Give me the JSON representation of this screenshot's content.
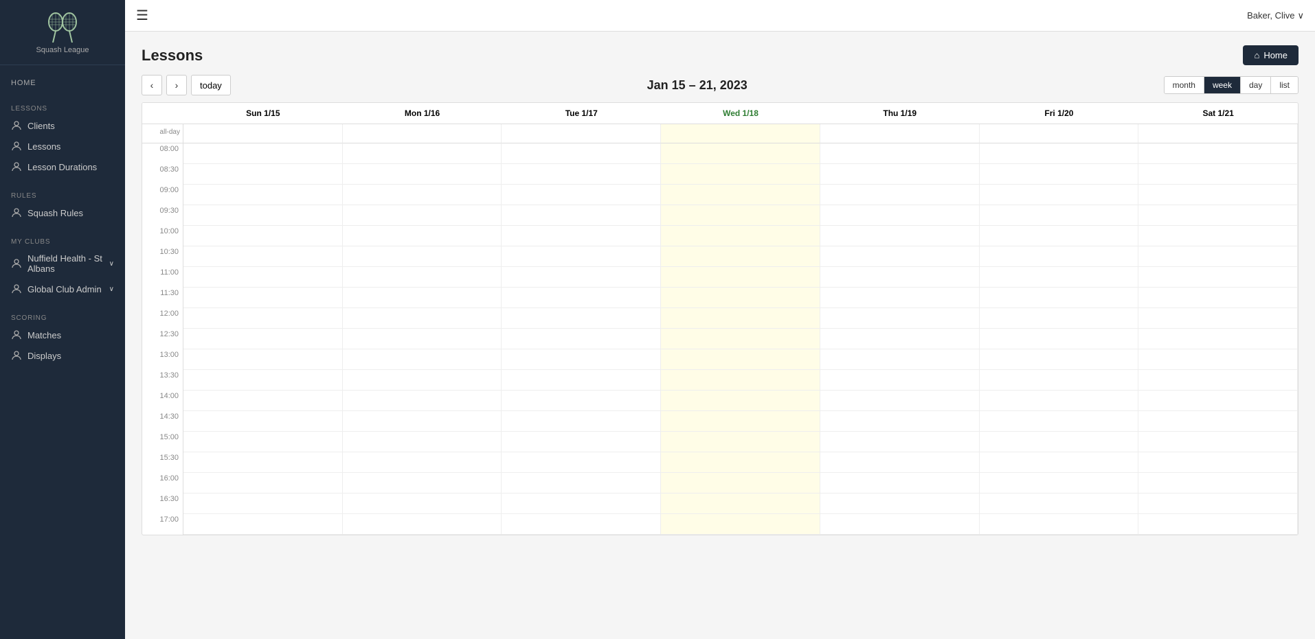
{
  "app": {
    "logo_text": "Squash League",
    "menu_icon": "☰"
  },
  "topbar": {
    "user_label": "Baker, Clive",
    "user_chevron": "∨"
  },
  "sidebar": {
    "home_label": "HOME",
    "sections": [
      {
        "name": "Lessons",
        "items": [
          {
            "id": "clients",
            "label": "Clients"
          },
          {
            "id": "lessons",
            "label": "Lessons"
          },
          {
            "id": "lesson-durations",
            "label": "Lesson Durations"
          }
        ]
      },
      {
        "name": "Rules",
        "items": [
          {
            "id": "squash-rules",
            "label": "Squash Rules"
          }
        ]
      },
      {
        "name": "My Clubs",
        "items": [
          {
            "id": "nuffield-health",
            "label": "Nuffield Health - St Albans",
            "has_chevron": true
          },
          {
            "id": "global-club-admin",
            "label": "Global Club Admin",
            "has_chevron": true
          }
        ]
      },
      {
        "name": "Scoring",
        "items": [
          {
            "id": "matches",
            "label": "Matches"
          },
          {
            "id": "displays",
            "label": "Displays"
          }
        ]
      }
    ]
  },
  "page": {
    "title": "Lessons",
    "home_button_label": "Home",
    "home_button_icon": "⌂"
  },
  "calendar": {
    "title": "Jan 15 – 21, 2023",
    "nav_prev": "‹",
    "nav_next": "›",
    "today_label": "today",
    "view_buttons": [
      "month",
      "week",
      "day",
      "list"
    ],
    "active_view": "week",
    "today_col_index": 4,
    "headers": [
      {
        "label": "Sun 1/15",
        "is_today": false
      },
      {
        "label": "Mon 1/16",
        "is_today": false
      },
      {
        "label": "Tue 1/17",
        "is_today": false
      },
      {
        "label": "Wed 1/18",
        "is_today": true
      },
      {
        "label": "Thu 1/19",
        "is_today": false
      },
      {
        "label": "Fri 1/20",
        "is_today": false
      },
      {
        "label": "Sat 1/21",
        "is_today": false
      }
    ],
    "time_slots": [
      "08:00",
      "08:30",
      "09:00",
      "09:30",
      "10:00",
      "10:30",
      "11:00",
      "11:30",
      "12:00",
      "12:30",
      "13:00",
      "13:30",
      "14:00",
      "14:30",
      "15:00",
      "15:30",
      "16:00",
      "16:30",
      "17:00"
    ]
  }
}
